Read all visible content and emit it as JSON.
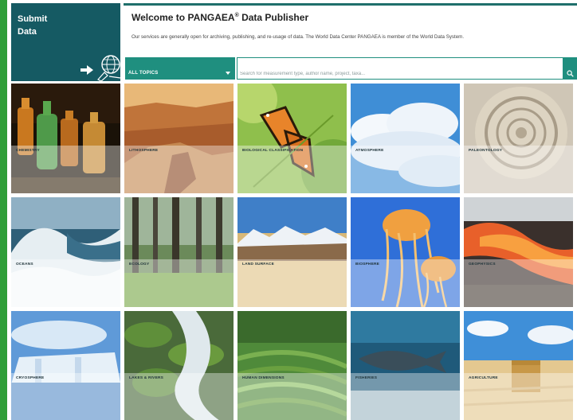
{
  "submit": {
    "label": "Submit\nData"
  },
  "header": {
    "title": "Welcome to PANGAEA",
    "title_mark": "®",
    "title_suffix": " Data Publisher",
    "description": "Our services are generally open for archiving, publishing, and re-usage of data. The World Data Center PANGAEA is member of the World Data System."
  },
  "topics": {
    "selected": "ALL TOPICS"
  },
  "search": {
    "placeholder": "Search for measurement type, author name, project, taxa..."
  },
  "colors": {
    "accent": "#1f8f7f",
    "brand_dark": "#155a63",
    "side_bar": "#2f9e38"
  },
  "tiles": [
    {
      "name": "CHEMISTRY",
      "count": "",
      "icon": "chemistry-bottles-photo"
    },
    {
      "name": "LITHOSPHERE",
      "count": "",
      "icon": "canyon-photo"
    },
    {
      "name": "BIOLOGICAL CLASSIFICATION",
      "count": "",
      "icon": "butterfly-photo"
    },
    {
      "name": "ATMOSPHERE",
      "count": "",
      "icon": "clouds-photo"
    },
    {
      "name": "PALEONTOLOGY",
      "count": "",
      "icon": "ammonite-photo"
    },
    {
      "name": "OCEANS",
      "count": "",
      "icon": "wave-photo"
    },
    {
      "name": "ECOLOGY",
      "count": "",
      "icon": "forest-photo"
    },
    {
      "name": "LAND SURFACE",
      "count": "",
      "icon": "mountains-photo"
    },
    {
      "name": "BIOSPHERE",
      "count": "",
      "icon": "jellyfish-photo"
    },
    {
      "name": "GEOPHYSICS",
      "count": "",
      "icon": "lava-photo"
    },
    {
      "name": "CRYOSPHERE",
      "count": "",
      "icon": "glacier-photo"
    },
    {
      "name": "LAKES & RIVERS",
      "count": "",
      "icon": "stream-photo"
    },
    {
      "name": "HUMAN DIMENSIONS",
      "count": "",
      "icon": "terraces-photo"
    },
    {
      "name": "FISHERIES",
      "count": "",
      "icon": "fish-photo"
    },
    {
      "name": "AGRICULTURE",
      "count": "",
      "icon": "hay-field-photo"
    }
  ]
}
